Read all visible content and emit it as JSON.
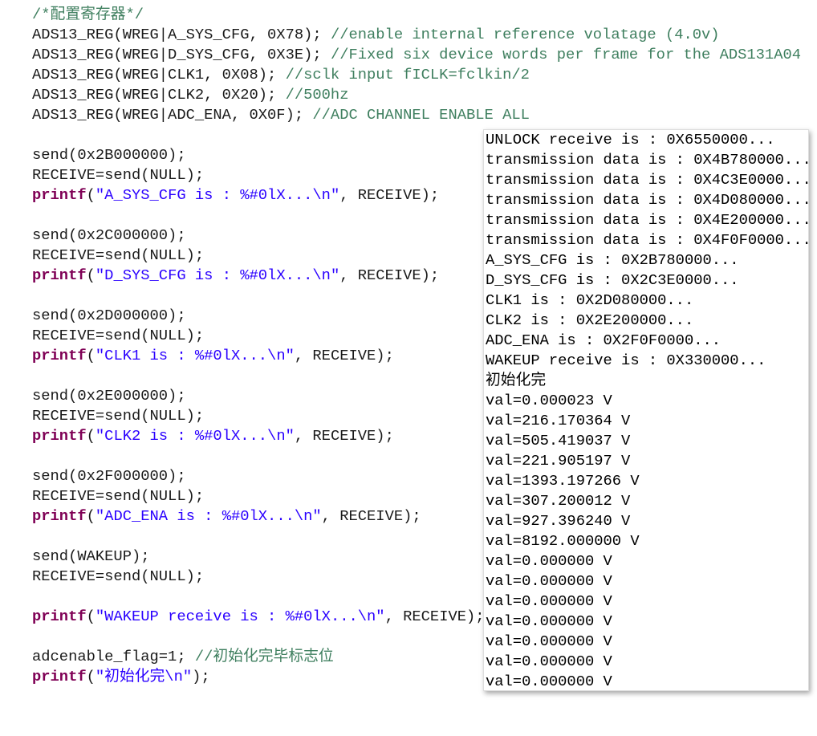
{
  "colors": {
    "comment": "#3f7f5f",
    "keyword": "#7f0055",
    "string": "#2a00ff",
    "text": "#1a1a1a"
  },
  "code_lines": [
    [
      [
        "cm",
        "/*配置寄存器*/"
      ]
    ],
    [
      [
        "pl",
        "ADS13_REG(WREG|A_SYS_CFG, 0X78); "
      ],
      [
        "cm",
        "//enable internal reference volatage (4.0v)"
      ]
    ],
    [
      [
        "pl",
        "ADS13_REG(WREG|D_SYS_CFG, 0X3E); "
      ],
      [
        "cm",
        "//Fixed six device words per frame for the ADS131A04"
      ]
    ],
    [
      [
        "pl",
        "ADS13_REG(WREG|CLK1, 0X08); "
      ],
      [
        "cm",
        "//sclk input fICLK=fclkin/2"
      ]
    ],
    [
      [
        "pl",
        "ADS13_REG(WREG|CLK2, 0X20); "
      ],
      [
        "cm",
        "//500hz"
      ]
    ],
    [
      [
        "pl",
        "ADS13_REG(WREG|ADC_ENA, 0X0F); "
      ],
      [
        "cm",
        "//ADC CHANNEL ENABLE ALL"
      ]
    ],
    [],
    [
      [
        "pl",
        "send(0x2B000000);"
      ]
    ],
    [
      [
        "pl",
        "RECEIVE=send(NULL);"
      ]
    ],
    [
      [
        "kw",
        "printf"
      ],
      [
        "pl",
        "("
      ],
      [
        "str",
        "\"A_SYS_CFG is : %#0lX...\\n\""
      ],
      [
        "pl",
        ", RECEIVE);"
      ]
    ],
    [],
    [
      [
        "pl",
        "send(0x2C000000);"
      ]
    ],
    [
      [
        "pl",
        "RECEIVE=send(NULL);"
      ]
    ],
    [
      [
        "kw",
        "printf"
      ],
      [
        "pl",
        "("
      ],
      [
        "str",
        "\"D_SYS_CFG is : %#0lX...\\n\""
      ],
      [
        "pl",
        ", RECEIVE);"
      ]
    ],
    [],
    [
      [
        "pl",
        "send(0x2D000000);"
      ]
    ],
    [
      [
        "pl",
        "RECEIVE=send(NULL);"
      ]
    ],
    [
      [
        "kw",
        "printf"
      ],
      [
        "pl",
        "("
      ],
      [
        "str",
        "\"CLK1 is : %#0lX...\\n\""
      ],
      [
        "pl",
        ", RECEIVE);"
      ]
    ],
    [],
    [
      [
        "pl",
        "send(0x2E000000);"
      ]
    ],
    [
      [
        "pl",
        "RECEIVE=send(NULL);"
      ]
    ],
    [
      [
        "kw",
        "printf"
      ],
      [
        "pl",
        "("
      ],
      [
        "str",
        "\"CLK2 is : %#0lX...\\n\""
      ],
      [
        "pl",
        ", RECEIVE);"
      ]
    ],
    [],
    [
      [
        "pl",
        "send(0x2F000000);"
      ]
    ],
    [
      [
        "pl",
        "RECEIVE=send(NULL);"
      ]
    ],
    [
      [
        "kw",
        "printf"
      ],
      [
        "pl",
        "("
      ],
      [
        "str",
        "\"ADC_ENA is : %#0lX...\\n\""
      ],
      [
        "pl",
        ", RECEIVE);"
      ]
    ],
    [],
    [
      [
        "pl",
        "send(WAKEUP);"
      ]
    ],
    [
      [
        "pl",
        "RECEIVE=send(NULL);"
      ]
    ],
    [],
    [
      [
        "kw",
        "printf"
      ],
      [
        "pl",
        "("
      ],
      [
        "str",
        "\"WAKEUP receive is : %#0lX...\\n\""
      ],
      [
        "pl",
        ", RECEIVE);"
      ]
    ],
    [],
    [
      [
        "pl",
        "adcenable_flag=1; "
      ],
      [
        "cm",
        "//初始化完毕标志位"
      ]
    ],
    [
      [
        "kw",
        "printf"
      ],
      [
        "pl",
        "("
      ],
      [
        "str",
        "\"初始化完\\n\""
      ],
      [
        "pl",
        ");"
      ]
    ]
  ],
  "console_lines": [
    "UNLOCK receive is : 0X6550000...",
    "transmission data is : 0X4B780000...",
    "transmission data is : 0X4C3E0000...",
    "transmission data is : 0X4D080000...",
    "transmission data is : 0X4E200000...",
    "transmission data is : 0X4F0F0000...",
    "A_SYS_CFG is : 0X2B780000...",
    "D_SYS_CFG is : 0X2C3E0000...",
    "CLK1 is : 0X2D080000...",
    "CLK2 is : 0X2E200000...",
    "ADC_ENA is : 0X2F0F0000...",
    "WAKEUP receive is : 0X330000...",
    "初始化完",
    "val=0.000023 V",
    "val=216.170364 V",
    "val=505.419037 V",
    "val=221.905197 V",
    "val=1393.197266 V",
    "val=307.200012 V",
    "val=927.396240 V",
    "val=8192.000000 V",
    "val=0.000000 V",
    "val=0.000000 V",
    "val=0.000000 V",
    "val=0.000000 V",
    "val=0.000000 V",
    "val=0.000000 V",
    "val=0.000000 V"
  ]
}
